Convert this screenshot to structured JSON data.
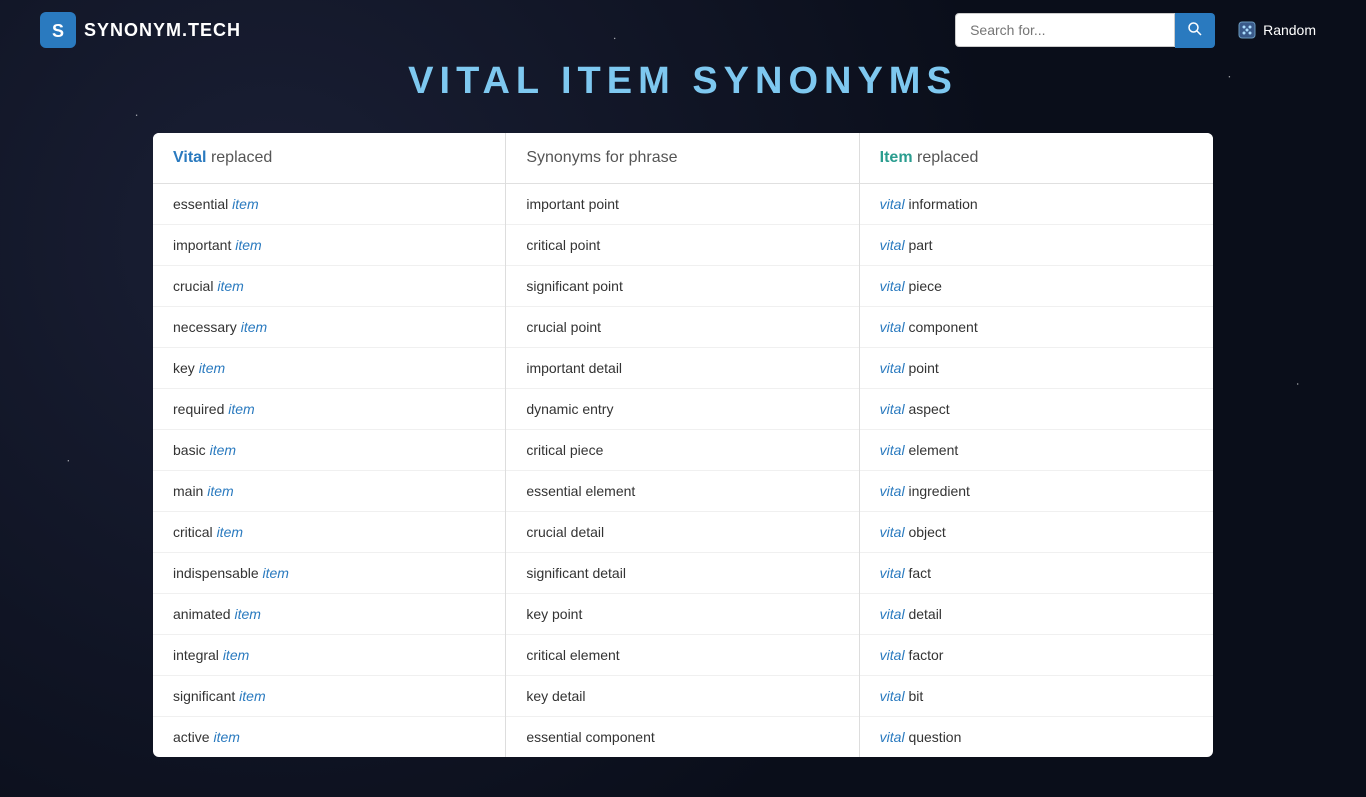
{
  "header": {
    "logo_text": "SYNONYM.TECH",
    "search_placeholder": "Search for...",
    "search_button_icon": "search",
    "random_button_label": "Random"
  },
  "page_title": {
    "word1": "VITAL",
    "word2": "ITEM",
    "rest": "SYNONYMS"
  },
  "columns": [
    {
      "id": "vital-replaced",
      "header_prefix": "Vital",
      "header_suffix": " replaced",
      "items": [
        {
          "pre": "essential ",
          "italic": "item"
        },
        {
          "pre": "important ",
          "italic": "item"
        },
        {
          "pre": "crucial ",
          "italic": "item"
        },
        {
          "pre": "necessary ",
          "italic": "item"
        },
        {
          "pre": "key ",
          "italic": "item"
        },
        {
          "pre": "required ",
          "italic": "item"
        },
        {
          "pre": "basic ",
          "italic": "item"
        },
        {
          "pre": "main ",
          "italic": "item"
        },
        {
          "pre": "critical ",
          "italic": "item"
        },
        {
          "pre": "indispensable ",
          "italic": "item"
        },
        {
          "pre": "animated ",
          "italic": "item"
        },
        {
          "pre": "integral ",
          "italic": "item"
        },
        {
          "pre": "significant ",
          "italic": "item"
        },
        {
          "pre": "active ",
          "italic": "item"
        }
      ]
    },
    {
      "id": "synonyms-phrase",
      "header_prefix": "Synonyms for phrase",
      "header_suffix": "",
      "items": [
        {
          "pre": "important point",
          "italic": ""
        },
        {
          "pre": "critical point",
          "italic": ""
        },
        {
          "pre": "significant point",
          "italic": ""
        },
        {
          "pre": "crucial point",
          "italic": ""
        },
        {
          "pre": "important detail",
          "italic": ""
        },
        {
          "pre": "dynamic entry",
          "italic": ""
        },
        {
          "pre": "critical piece",
          "italic": ""
        },
        {
          "pre": "essential element",
          "italic": ""
        },
        {
          "pre": "crucial detail",
          "italic": ""
        },
        {
          "pre": "significant detail",
          "italic": ""
        },
        {
          "pre": "key point",
          "italic": ""
        },
        {
          "pre": "critical element",
          "italic": ""
        },
        {
          "pre": "key detail",
          "italic": ""
        },
        {
          "pre": "essential component",
          "italic": ""
        }
      ]
    },
    {
      "id": "item-replaced",
      "header_prefix": "Item",
      "header_suffix": " replaced",
      "items": [
        {
          "pre": "",
          "italic": "vital",
          "post": " information"
        },
        {
          "pre": "",
          "italic": "vital",
          "post": " part"
        },
        {
          "pre": "",
          "italic": "vital",
          "post": " piece"
        },
        {
          "pre": "",
          "italic": "vital",
          "post": " component"
        },
        {
          "pre": "",
          "italic": "vital",
          "post": " point"
        },
        {
          "pre": "",
          "italic": "vital",
          "post": " aspect"
        },
        {
          "pre": "",
          "italic": "vital",
          "post": " element"
        },
        {
          "pre": "",
          "italic": "vital",
          "post": " ingredient"
        },
        {
          "pre": "",
          "italic": "vital",
          "post": " object"
        },
        {
          "pre": "",
          "italic": "vital",
          "post": " fact"
        },
        {
          "pre": "",
          "italic": "vital",
          "post": " detail"
        },
        {
          "pre": "",
          "italic": "vital",
          "post": " factor"
        },
        {
          "pre": "",
          "italic": "vital",
          "post": " bit"
        },
        {
          "pre": "",
          "italic": "vital",
          "post": " question"
        }
      ]
    }
  ]
}
